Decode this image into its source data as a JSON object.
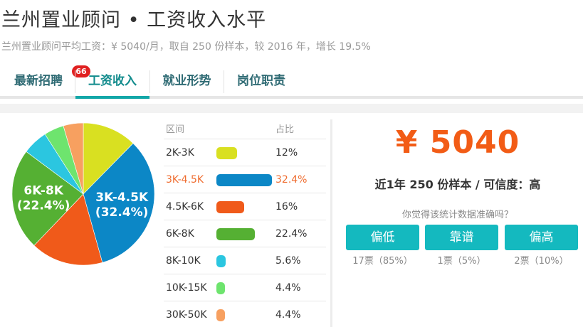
{
  "header": {
    "title": "兰州置业顾问 • 工资收入水平",
    "subtitle": "兰州置业顾问平均工资：¥ 5040/月，取自 250 份样本，较 2016 年，增长 19.5%"
  },
  "tabs": [
    {
      "label": "最新招聘",
      "badge": "66",
      "active": false
    },
    {
      "label": "工资收入",
      "active": true
    },
    {
      "label": "就业形势",
      "active": false
    },
    {
      "label": "岗位职责",
      "active": false
    }
  ],
  "chart_data": {
    "type": "pie",
    "categories": [
      "2K-3K",
      "3K-4.5K",
      "4.5K-6K",
      "6K-8K",
      "8K-10K",
      "10K-15K",
      "30K-50K"
    ],
    "values": [
      12,
      32.4,
      16,
      22.4,
      5.6,
      4.4,
      4.4
    ],
    "colors": [
      "#d9e021",
      "#0c87c6",
      "#f05a1a",
      "#55b033",
      "#2bc6e0",
      "#6ee46e",
      "#f7a060"
    ],
    "pie_labels": [
      {
        "index": 1,
        "line1": "3K-4.5K",
        "line2": "(32.4%)"
      },
      {
        "index": 3,
        "line1": "6K-8K",
        "line2": "(22.4%)"
      }
    ],
    "legend": {
      "header_range": "区间",
      "header_pct": "占比",
      "rows": [
        {
          "range": "2K-3K",
          "pct": "12%",
          "value": 12
        },
        {
          "range": "3K-4.5K",
          "pct": "32.4%",
          "value": 32.4,
          "highlight": true
        },
        {
          "range": "4.5K-6K",
          "pct": "16%",
          "value": 16
        },
        {
          "range": "6K-8K",
          "pct": "22.4%",
          "value": 22.4
        },
        {
          "range": "8K-10K",
          "pct": "5.6%",
          "value": 5.6
        },
        {
          "range": "10K-15K",
          "pct": "4.4%",
          "value": 4.4
        },
        {
          "range": "30K-50K",
          "pct": "4.4%",
          "value": 4.4
        }
      ]
    }
  },
  "summary": {
    "average": "¥ 5040",
    "sample_text": "近1年 250 份样本 / 可信度：高",
    "question": "你觉得该统计数据准确吗？",
    "votes": [
      {
        "label": "偏低",
        "count": "17票（85%）"
      },
      {
        "label": "靠谱",
        "count": "1票（5%）"
      },
      {
        "label": "偏高",
        "count": "2票（10%）"
      }
    ]
  }
}
